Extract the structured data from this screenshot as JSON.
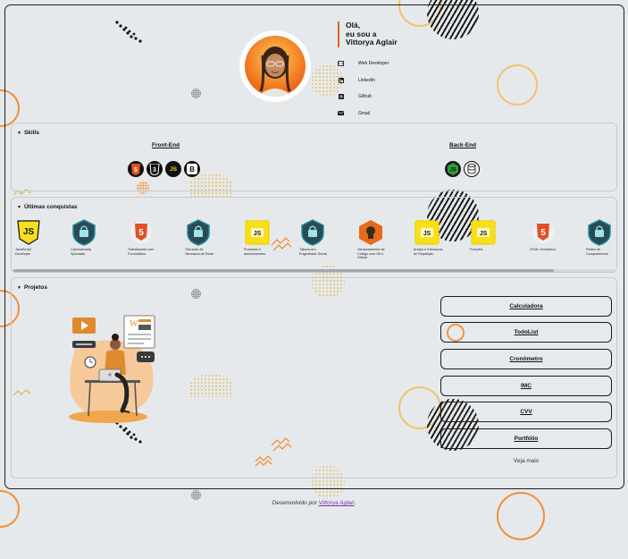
{
  "hero": {
    "greeting_line1": "Olá,",
    "greeting_line2": "eu sou a",
    "name": "Vittorya Aglair",
    "photo_alt": "Vittorya Aglair"
  },
  "contacts": [
    {
      "label": "Web Developer",
      "icon": "code-icon"
    },
    {
      "label": "LinkedIn",
      "icon": "linkedin-icon"
    },
    {
      "label": "Github",
      "icon": "github-icon"
    },
    {
      "label": "Gmail",
      "icon": "mail-icon"
    }
  ],
  "skills": {
    "title": "Skills",
    "frontend_title": "Front-End",
    "backend_title": "Back-End",
    "frontend": [
      {
        "name": "HTML5",
        "glyph": "5",
        "color": "#e34f26"
      },
      {
        "name": "CSS3",
        "glyph": "3",
        "color": "#111111"
      },
      {
        "name": "JavaScript",
        "glyph": "JS",
        "color": "#f7df1e"
      },
      {
        "name": "Bootstrap",
        "glyph": "B",
        "color": "#111111"
      }
    ],
    "backend": [
      {
        "name": "Node.js",
        "glyph": "JS",
        "color": "#2f9e3a"
      },
      {
        "name": "Database",
        "glyph": "≡",
        "color": "#ffffff"
      }
    ]
  },
  "achievements": {
    "title": "Últimas conquistas",
    "items": [
      {
        "label": "JavaScript Developer",
        "type": "js-badge"
      },
      {
        "label": "Cybersecurity Specialist",
        "type": "shield-badge"
      },
      {
        "label": "Trabalhando com Formulários",
        "type": "html-badge"
      },
      {
        "label": "Técnicas de Varredura de Rede",
        "type": "shield-badge"
      },
      {
        "label": "Promises e assincronismo",
        "type": "js-square"
      },
      {
        "label": "Táticos em Engenharia Social",
        "type": "shield-badge"
      },
      {
        "label": "Versionamento de Código com Git e Github",
        "type": "git-badge"
      },
      {
        "label": "Arrays e Estruturas de Repetição",
        "type": "js-square"
      },
      {
        "label": "Funções",
        "type": "js-square"
      },
      {
        "label": "HTML Semântico",
        "type": "html-badge"
      },
      {
        "label": "Redes de Computadores",
        "type": "shield-badge"
      }
    ]
  },
  "projects": {
    "title": "Projetos",
    "items": [
      "Calculadora",
      "TodoList",
      "Cronômetro",
      "IMC",
      "CVV",
      "Portfólio"
    ],
    "see_more": "Veja mais"
  },
  "footer": {
    "prefix": "Desenvolvido por",
    "author": "Vittorya Aglair",
    "suffix": "."
  }
}
